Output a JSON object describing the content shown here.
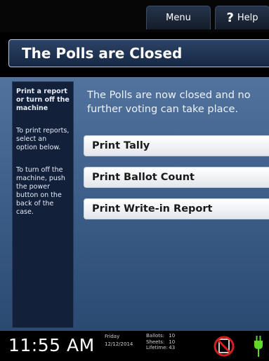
{
  "header": {
    "menu_label": "Menu",
    "help_icon": "?",
    "help_label": "Help"
  },
  "title": "The Polls are Closed",
  "sidebar": {
    "heading": "Print a report or turn off the machine",
    "instruction_print": "To print reports, select an option below.",
    "instruction_power": "To turn off the machine, push the power button on the back of the case."
  },
  "main": {
    "message": "The Polls are now closed and no further voting can take place.",
    "buttons": [
      {
        "label": "Print Tally"
      },
      {
        "label": "Print Ballot Count"
      },
      {
        "label": "Print Write-in Report"
      }
    ]
  },
  "status": {
    "time": "11:55 AM",
    "day": "Friday",
    "date": "12/12/2014",
    "ballots_label": "Ballots:",
    "ballots_value": "10",
    "sheets_label": "Sheets:",
    "sheets_value": "10",
    "lifetime_label": "Lifetime:",
    "lifetime_value": "43"
  },
  "icons": {
    "no_paper": "no-paper-icon",
    "power": "power-plug-icon"
  },
  "colors": {
    "accent_blue": "#2b4366",
    "warning_red": "#d21f1f",
    "power_green": "#5fd82a"
  }
}
